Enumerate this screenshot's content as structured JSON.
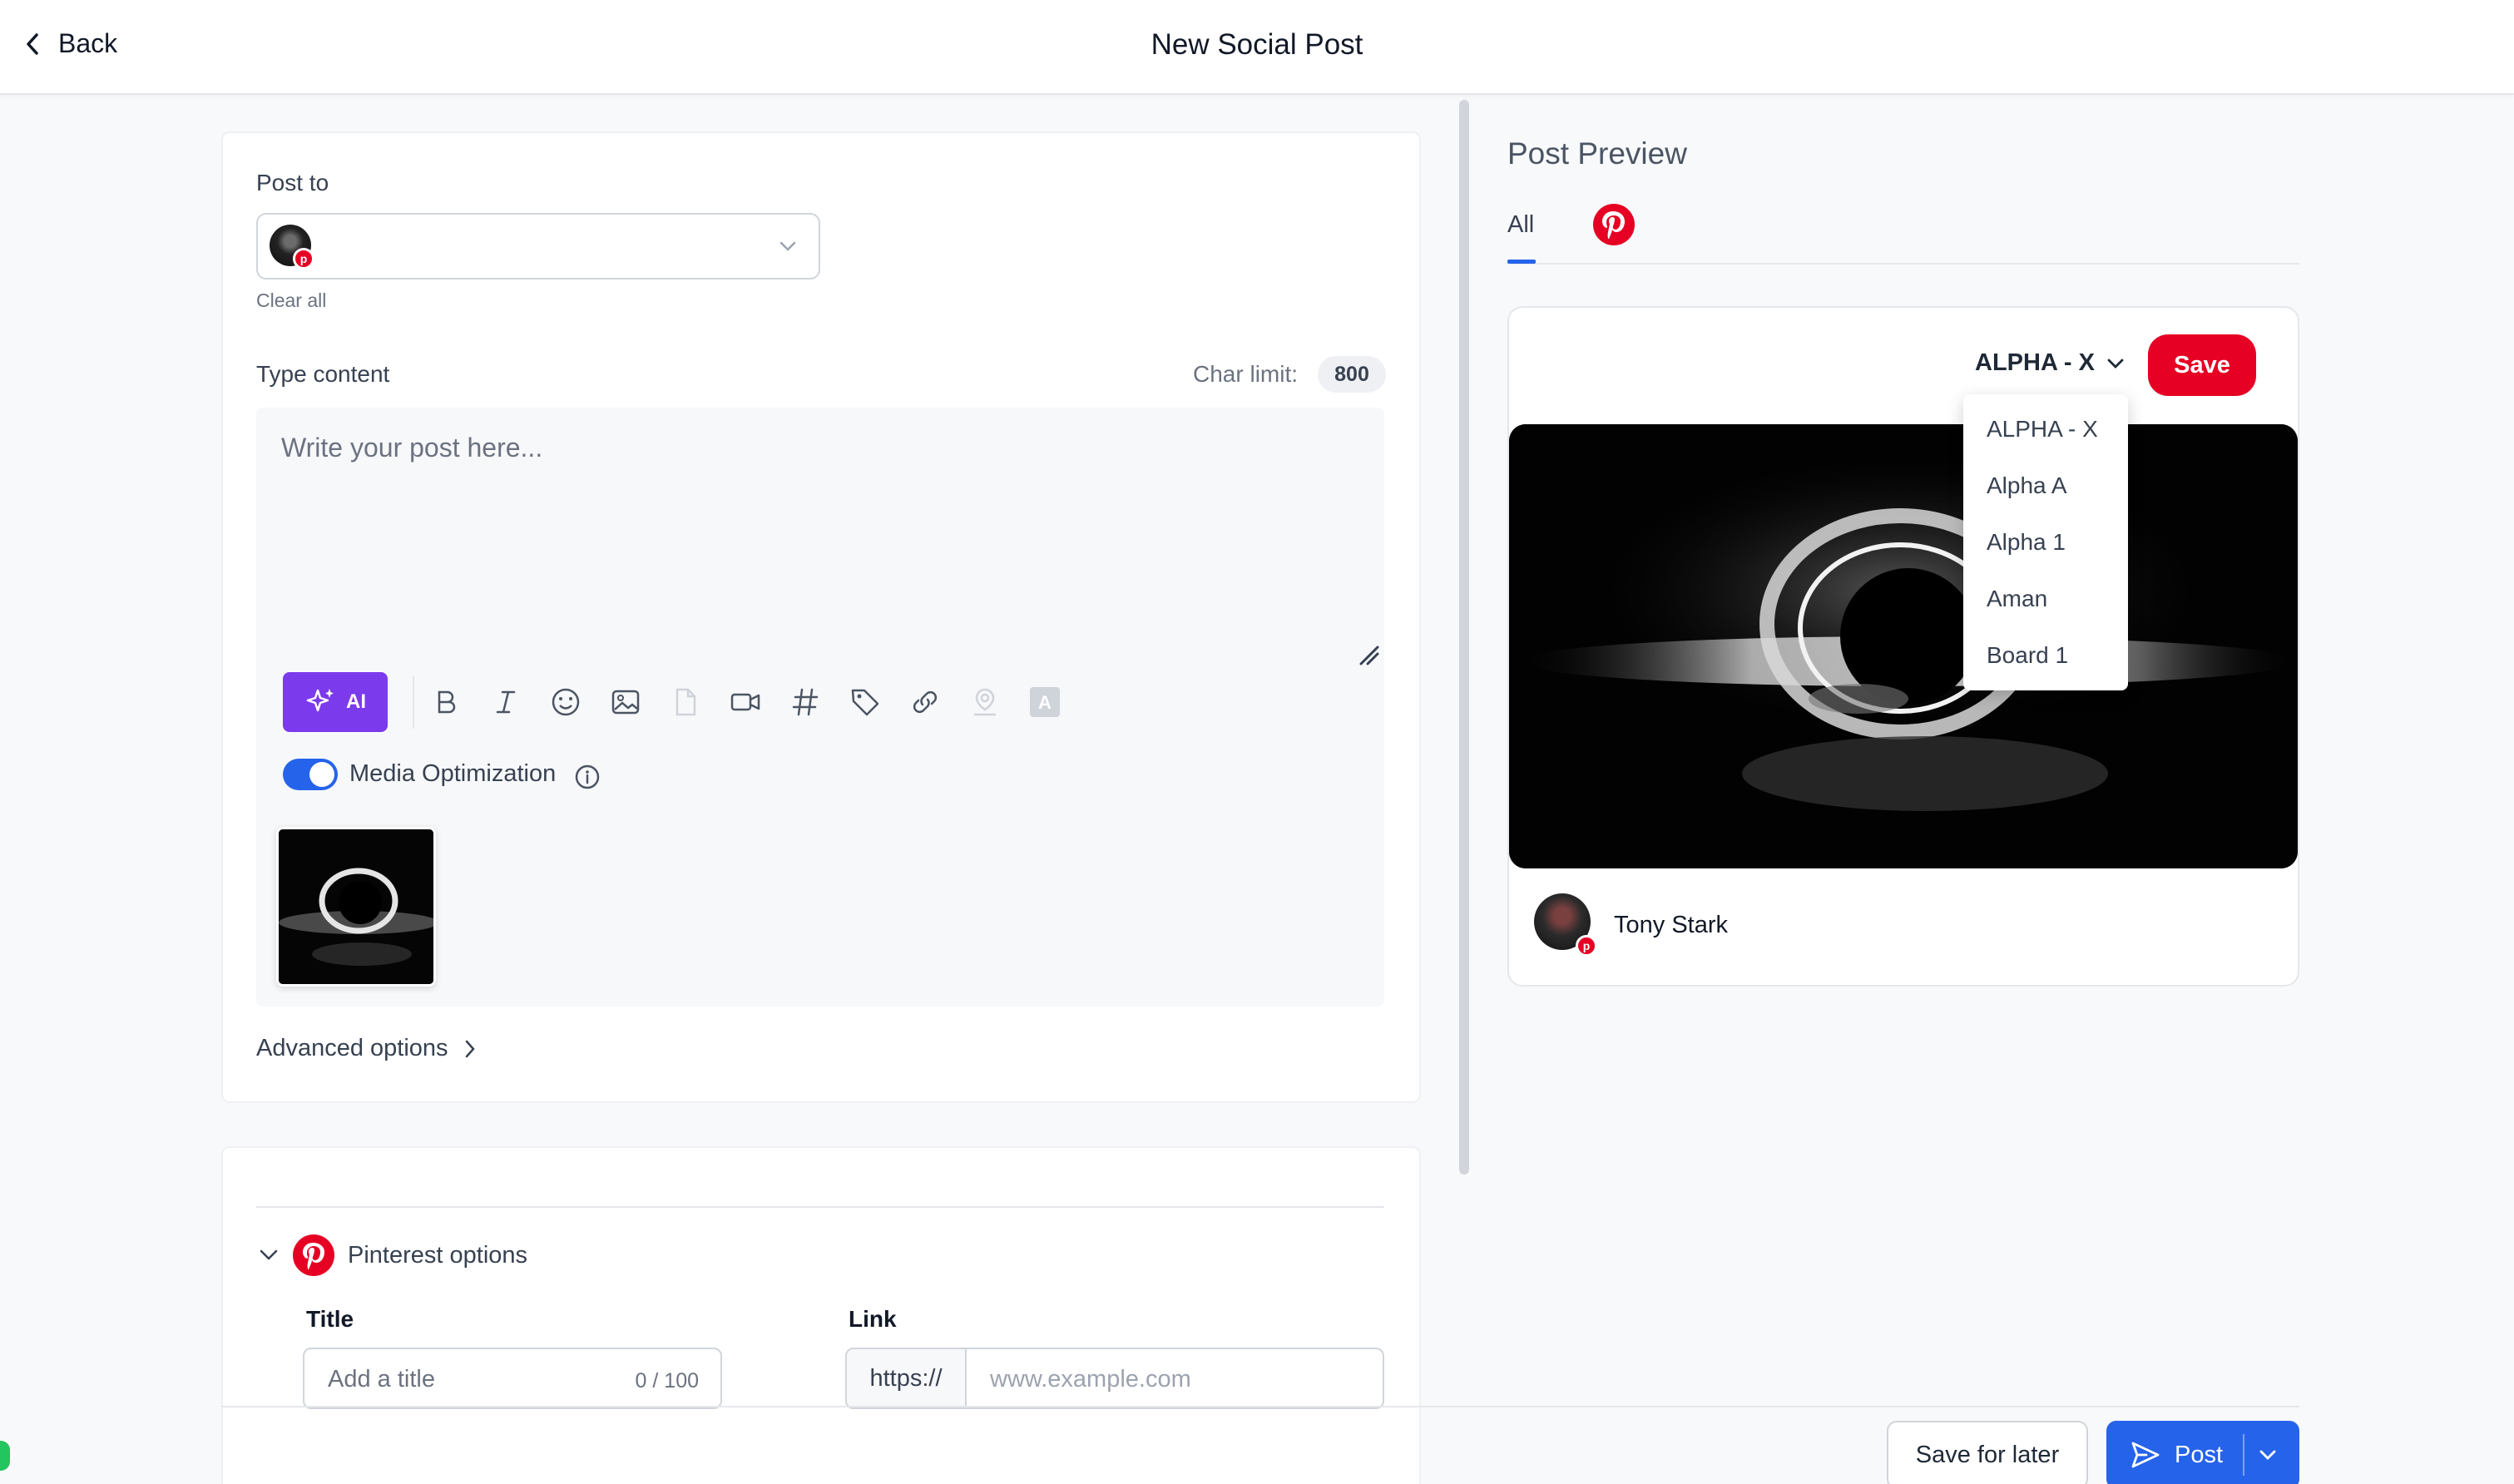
{
  "header": {
    "back_label": "Back",
    "title": "New Social Post"
  },
  "compose": {
    "post_to_label": "Post to",
    "clear_all": "Clear all",
    "type_content_label": "Type content",
    "char_limit_label": "Char limit:",
    "char_limit_value": "800",
    "placeholder": "Write your post here...",
    "ai_label": "AI",
    "toolbar_icons": [
      "bold-icon",
      "italic-icon",
      "emoji-icon",
      "image-icon",
      "file-icon",
      "video-icon",
      "hashtag-icon",
      "tag-icon",
      "link-icon",
      "location-icon",
      "text-style-icon"
    ],
    "media_optimization_label": "Media Optimization",
    "media_optimization_on": true,
    "advanced_options": "Advanced options"
  },
  "pinterest": {
    "section_label": "Pinterest options",
    "title_label": "Title",
    "title_placeholder": "Add a title",
    "title_counter": "0 / 100",
    "link_label": "Link",
    "link_prefix": "https://",
    "link_placeholder": "www.example.com"
  },
  "preview": {
    "title": "Post Preview",
    "tab_all": "All",
    "board_selected": "ALPHA - X",
    "save_label": "Save",
    "boards": [
      "ALPHA - X",
      "Alpha A",
      "Alpha 1",
      "Aman",
      "Board 1"
    ],
    "account_name": "Tony Stark"
  },
  "footer": {
    "save_later": "Save for later",
    "post": "Post"
  },
  "colors": {
    "primary": "#2563eb",
    "pinterest": "#e60023",
    "ai": "#7c3aed"
  }
}
